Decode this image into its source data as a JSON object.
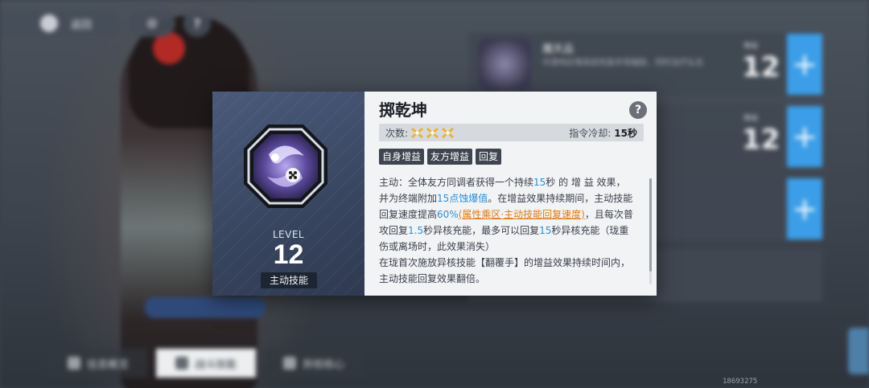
{
  "background": {
    "top_bar": {
      "back_label": "返回"
    },
    "skills": [
      {
        "name": "魔天品",
        "desc": "中游响应堆高底恢复并增幅敌，同时治疗弘击",
        "level_small": "等级",
        "level": "12"
      },
      {
        "name": "",
        "desc": "",
        "level_small": "等级",
        "level": "12"
      },
      {
        "name": "",
        "desc": "",
        "level_small": "",
        "level": ""
      }
    ],
    "bottom_tabs": [
      "信息概览",
      "战斗技能",
      "异核核心"
    ],
    "uid": "18693275"
  },
  "popup": {
    "level_label": "LEVEL",
    "level": "12",
    "type": "主动技能",
    "title": "掷乾坤",
    "help_symbol": "?",
    "charges_label": "次数:",
    "cooldown_label": "指令冷却:",
    "cooldown_value": "15秒",
    "tags": [
      "自身增益",
      "友方增益",
      "回复"
    ],
    "desc": {
      "p1": "主动：全体友方同调者获得一个持续",
      "p1_dur": "15",
      "p2": "秒 的 增 益 效果，并为终端附加",
      "p2_val": "15点蚀爆值",
      "p3": "。在增益效果持续期间，主动技能回复速度提高",
      "p3_val": "60%",
      "p3_link": "(属性乘区·主动技能回复速度)",
      "p4": "，且每次普攻回复",
      "p4_val": "1.5",
      "p5": "秒异核充能，最多可以回复",
      "p5_val": "15",
      "p6": "秒异核充能（珑重伤或离场时，此效果消失）",
      "p7": "在珑首次施放异核技能【翻覆手】的增益效果持续时间内，主动技能回复效果翻倍。"
    },
    "colors": {
      "highlight": "#2a8fd8",
      "link": "#e07a12",
      "charge": "#e8b33c"
    }
  }
}
